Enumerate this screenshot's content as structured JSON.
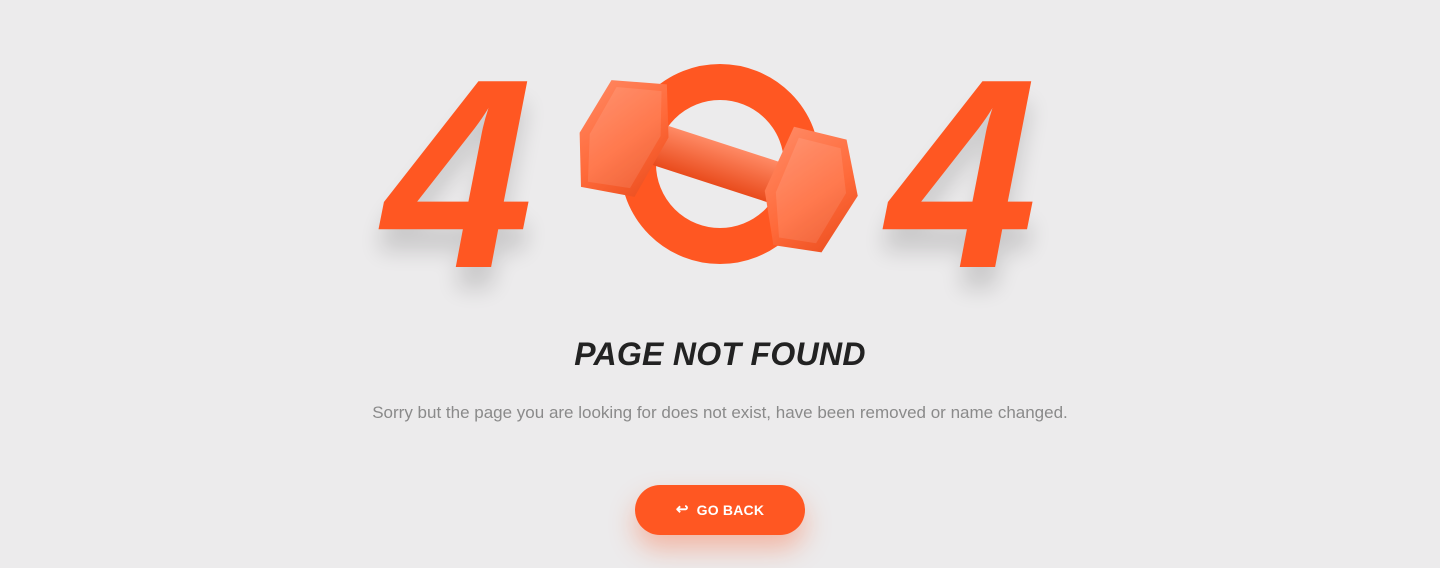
{
  "error_code": {
    "first_digit": "4",
    "last_digit": "4",
    "middle_graphic_icon": "dumbbell-icon"
  },
  "content": {
    "title": "PAGE NOT FOUND",
    "message": "Sorry but the page you are looking for does not exist, have been removed or name changed."
  },
  "actions": {
    "go_back_icon": "↩",
    "go_back_label": "GO BACK"
  },
  "colors": {
    "background": "#ECEBEC",
    "accent": "#FF5722",
    "title": "#222222",
    "message": "#8A8A8A"
  }
}
